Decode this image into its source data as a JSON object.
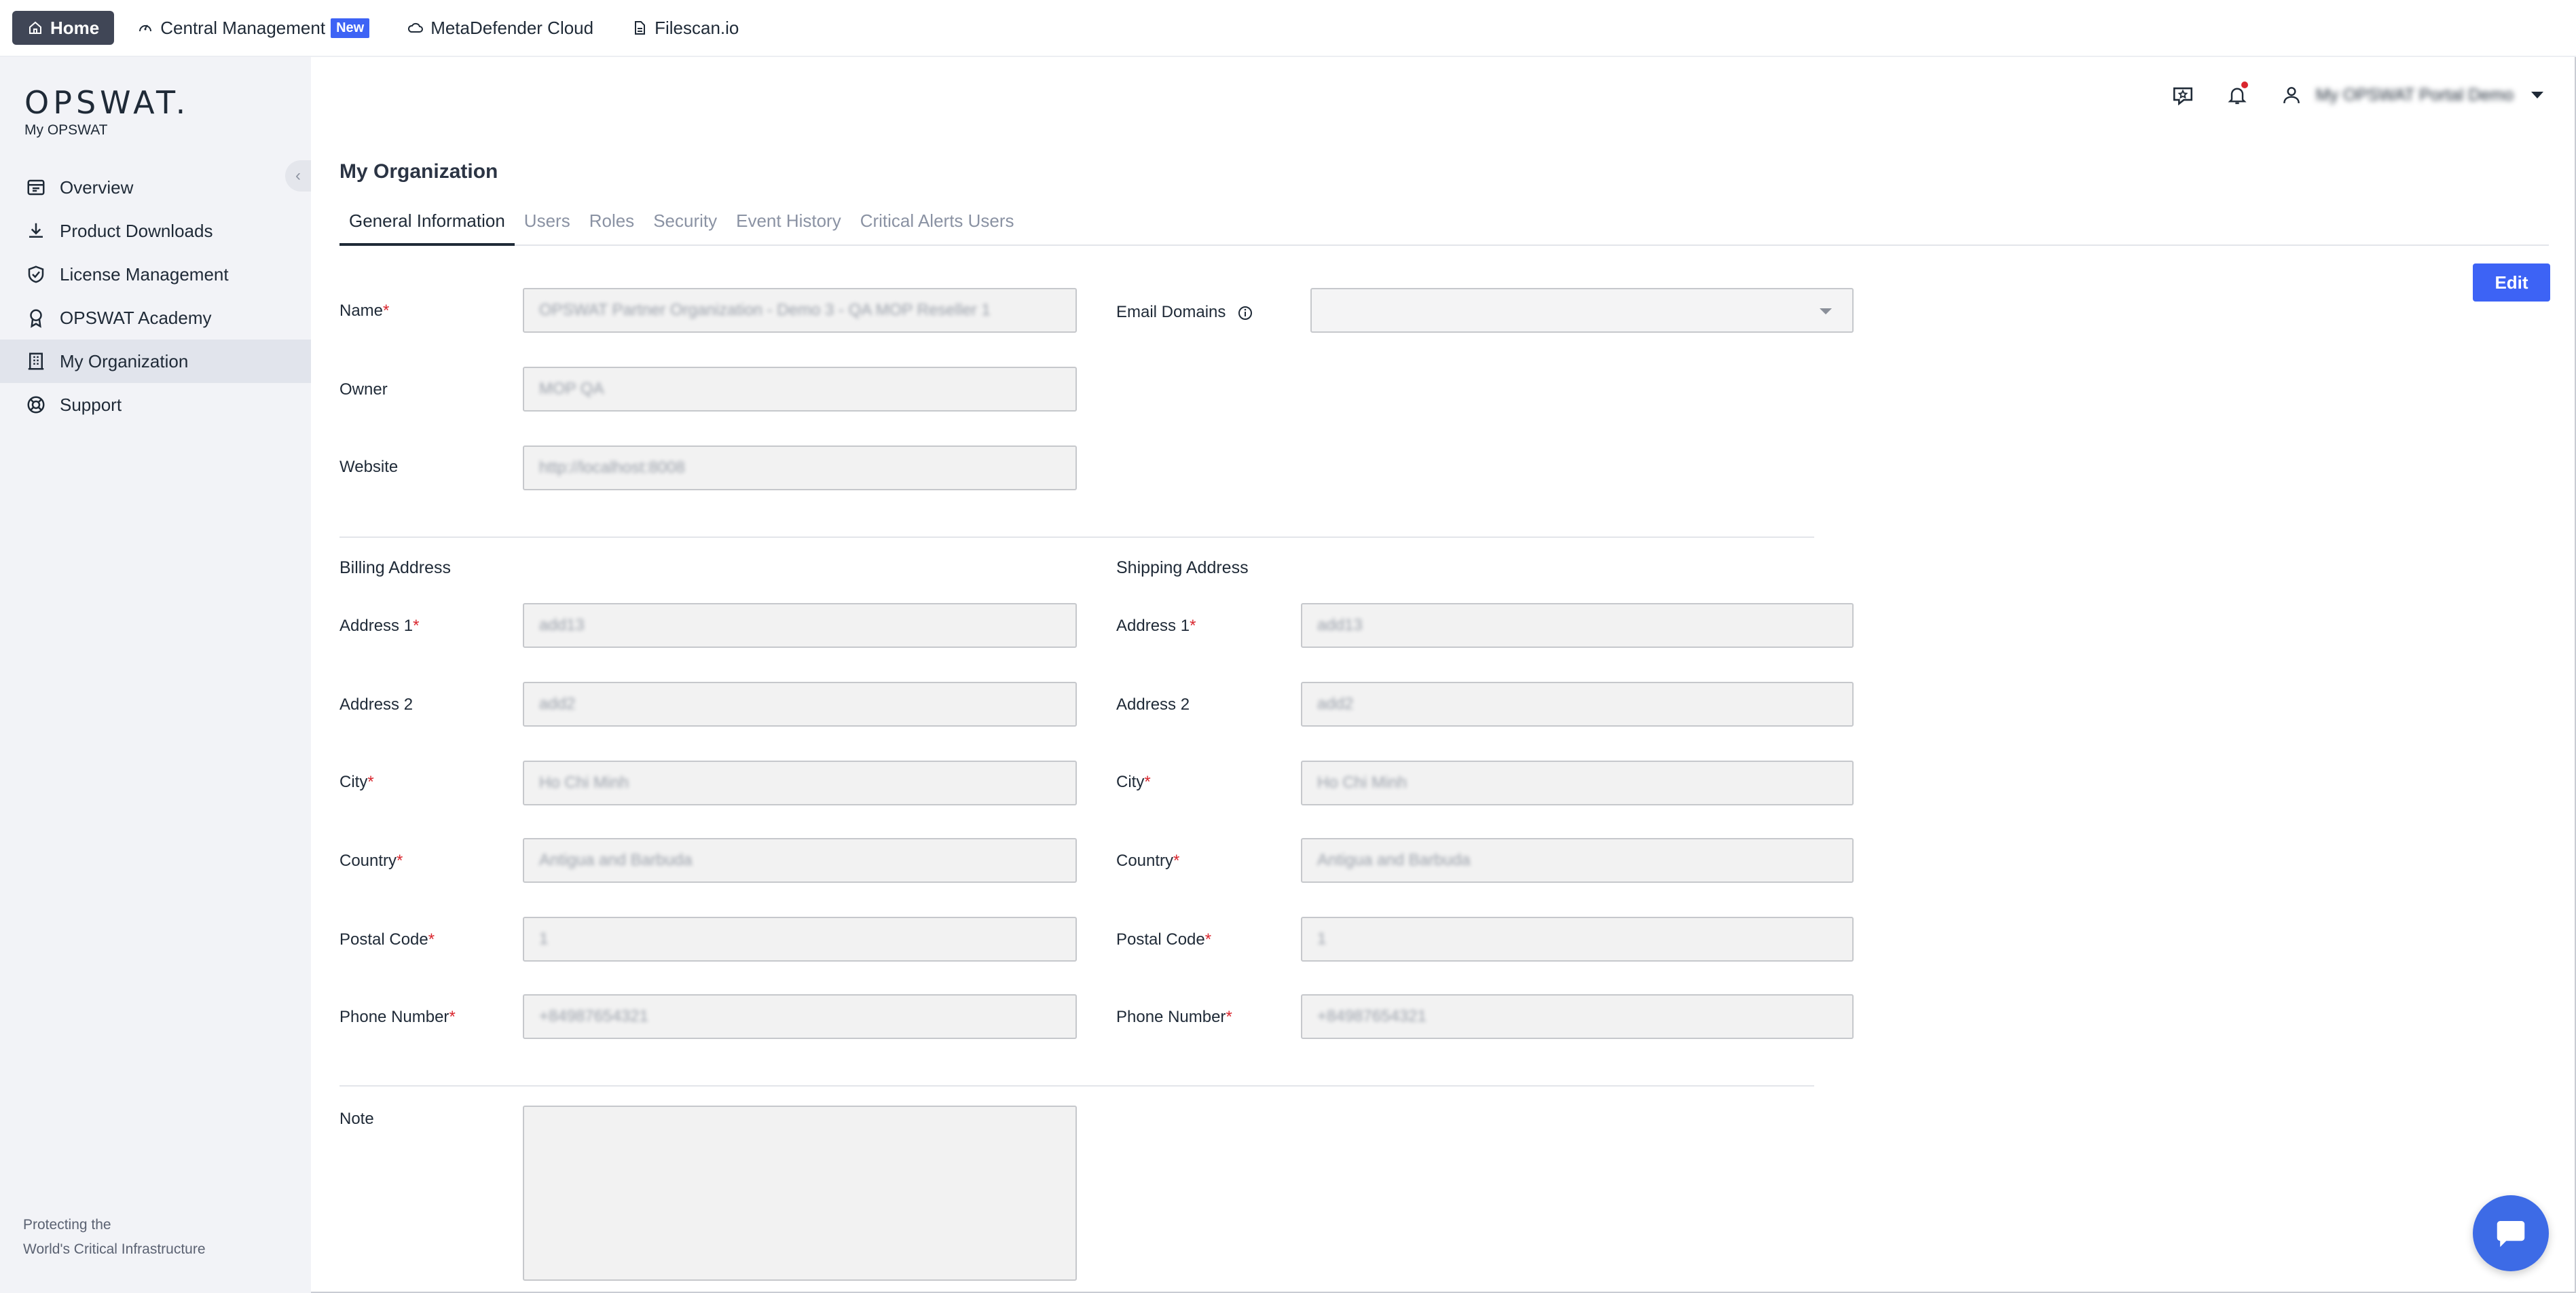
{
  "topbar": {
    "tabs": [
      {
        "label": "Home",
        "icon": "home-icon"
      },
      {
        "label": "Central Management",
        "icon": "gauge-icon",
        "badge": "New"
      },
      {
        "label": "MetaDefender Cloud",
        "icon": "cloud-icon"
      },
      {
        "label": "Filescan.io",
        "icon": "file-icon"
      }
    ]
  },
  "sidebar": {
    "logo_word": "OPSWAT.",
    "logo_sub": "My OPSWAT",
    "items": [
      {
        "label": "Overview",
        "icon": "overview-icon"
      },
      {
        "label": "Product Downloads",
        "icon": "download-icon"
      },
      {
        "label": "License Management",
        "icon": "license-icon"
      },
      {
        "label": "OPSWAT Academy",
        "icon": "academy-icon"
      },
      {
        "label": "My Organization",
        "icon": "building-icon",
        "active": true
      },
      {
        "label": "Support",
        "icon": "support-icon"
      }
    ],
    "tagline_line1": "Protecting the",
    "tagline_line2": "World's Critical Infrastructure"
  },
  "header": {
    "user_name": "My OPSWAT Portal Demo"
  },
  "main": {
    "title": "My Organization",
    "tabs": [
      "General Information",
      "Users",
      "Roles",
      "Security",
      "Event History",
      "Critical Alerts Users"
    ],
    "active_tab": "General Information",
    "edit_label": "Edit",
    "fields": {
      "name_label": "Name",
      "name_value": "OPSWAT Partner Organization - Demo 3 - QA MOP Reseller 1",
      "owner_label": "Owner",
      "owner_value": "MOP QA",
      "website_label": "Website",
      "website_value": "http://localhost:8008",
      "email_domains_label": "Email Domains",
      "email_domains_value": ""
    },
    "billing": {
      "title": "Billing Address",
      "address1_label": "Address 1",
      "address1_value": "add13",
      "address2_label": "Address 2",
      "address2_value": "add2",
      "city_label": "City",
      "city_value": "Ho Chi Minh",
      "country_label": "Country",
      "country_value": "Antigua and Barbuda",
      "postal_label": "Postal Code",
      "postal_value": "1",
      "phone_label": "Phone Number",
      "phone_value": "+84987654321"
    },
    "shipping": {
      "title": "Shipping Address",
      "address1_label": "Address 1",
      "address1_value": "add13",
      "address2_label": "Address 2",
      "address2_value": "add2",
      "city_label": "City",
      "city_value": "Ho Chi Minh",
      "country_label": "Country",
      "country_value": "Antigua and Barbuda",
      "postal_label": "Postal Code",
      "postal_value": "1",
      "phone_label": "Phone Number",
      "phone_value": "+84987654321"
    },
    "note_label": "Note",
    "note_value": ""
  },
  "colors": {
    "accent": "#3d63f5",
    "required": "#d9262e",
    "sidebar_bg": "#f2f3f7",
    "home_tab_bg": "#404656"
  }
}
